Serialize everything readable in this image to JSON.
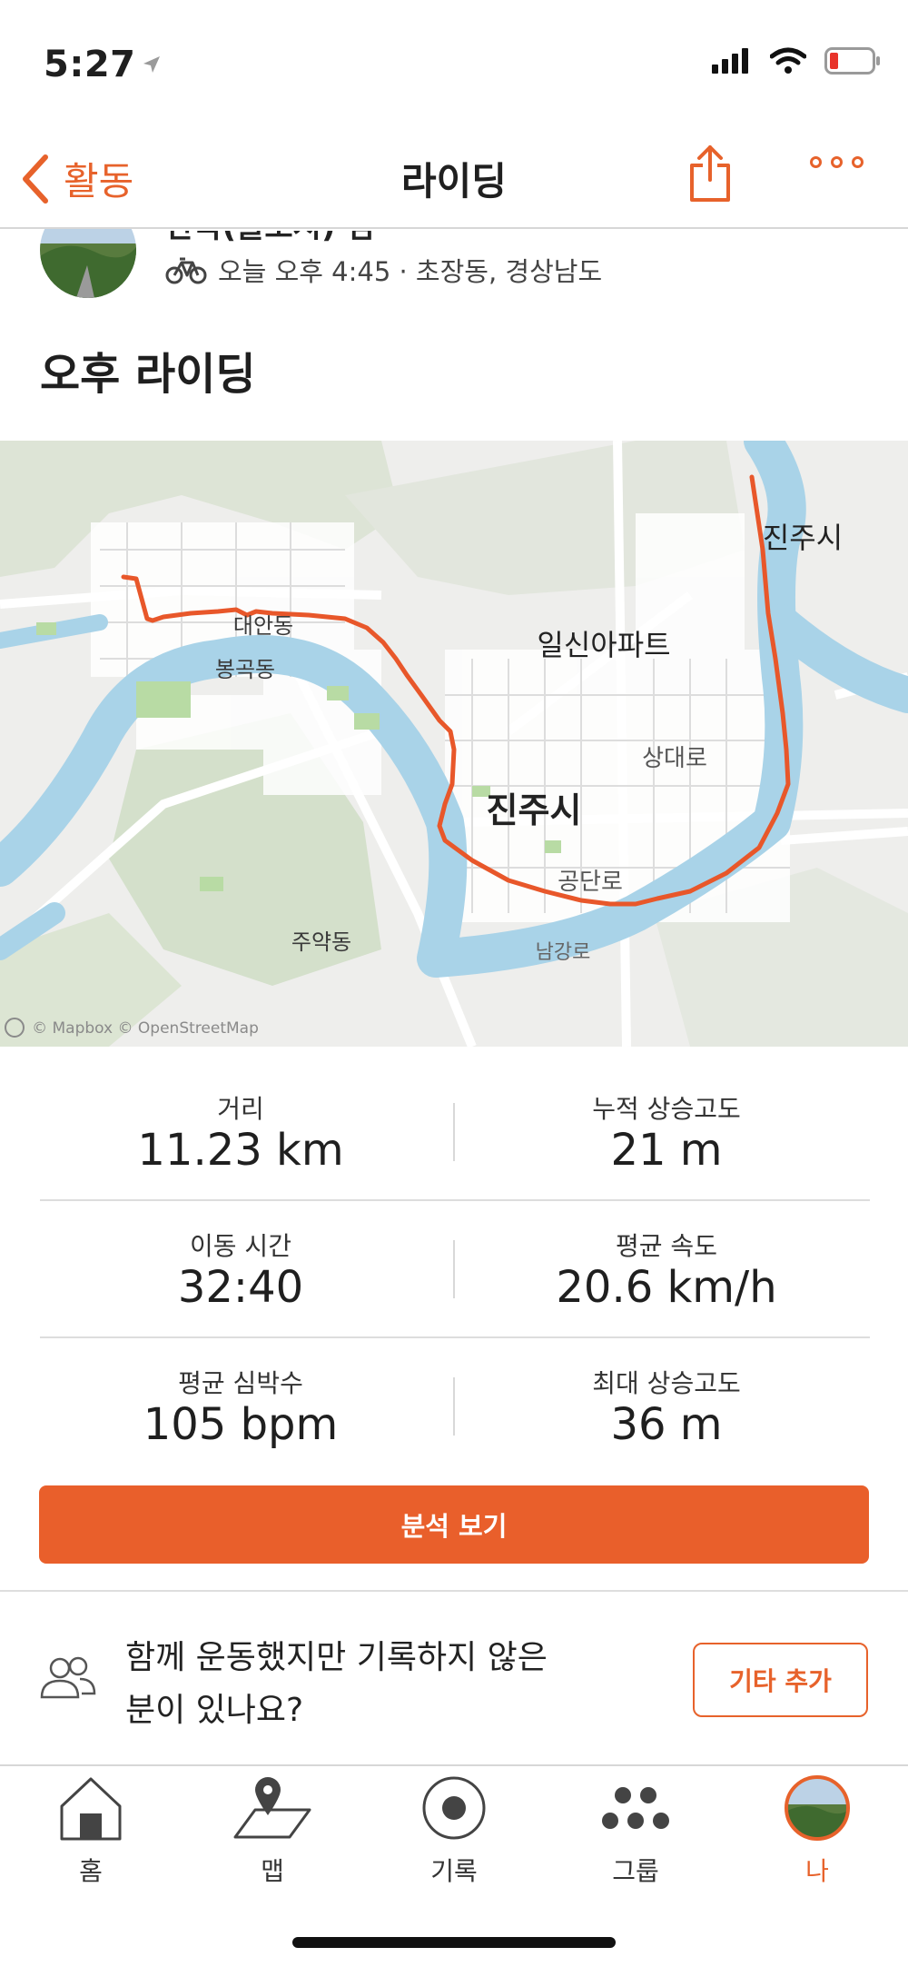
{
  "status": {
    "time": "5:27"
  },
  "nav": {
    "back_label": "활동",
    "title": "라이딩"
  },
  "activity": {
    "athlete_name_partial": "한국(들도시) 님",
    "meta": "오늘 오후 4:45 · 초장동, 경상남도",
    "title": "오후 라이딩"
  },
  "map": {
    "labels": {
      "daean": "대안동",
      "bongok": "봉곡동",
      "ilsin": "일신아파트",
      "jinju_top": "진주시",
      "sangdae": "상대로",
      "jinju_center": "진주시",
      "gongdan": "공단로",
      "juyak": "주약동",
      "namgang": "남강로"
    },
    "attribution": "© Mapbox © OpenStreetMap",
    "route_color": "#e8572a",
    "water_color": "#a9d3e8"
  },
  "stats": {
    "distance": {
      "label": "거리",
      "value": "11.23 km"
    },
    "elev_gain": {
      "label": "누적 상승고도",
      "value": "21 m"
    },
    "moving_time": {
      "label": "이동 시간",
      "value": "32:40"
    },
    "avg_speed": {
      "label": "평균 속도",
      "value": "20.6 km/h"
    },
    "avg_hr": {
      "label": "평균 심박수",
      "value": "105 bpm"
    },
    "max_elev": {
      "label": "최대 상승고도",
      "value": "36 m"
    }
  },
  "analysis_button": "분석 보기",
  "together": {
    "text_line1": "함께 운동했지만 기록하지 않은",
    "text_line2": "분이 있나요?",
    "add_button": "기타 추가"
  },
  "tabs": [
    {
      "label": "홈",
      "icon": "home-icon"
    },
    {
      "label": "맵",
      "icon": "map-icon"
    },
    {
      "label": "기록",
      "icon": "record-icon"
    },
    {
      "label": "그룹",
      "icon": "groups-icon"
    },
    {
      "label": "나",
      "icon": "avatar"
    }
  ],
  "colors": {
    "accent": "#e7622b",
    "button": "#e95f2b"
  }
}
